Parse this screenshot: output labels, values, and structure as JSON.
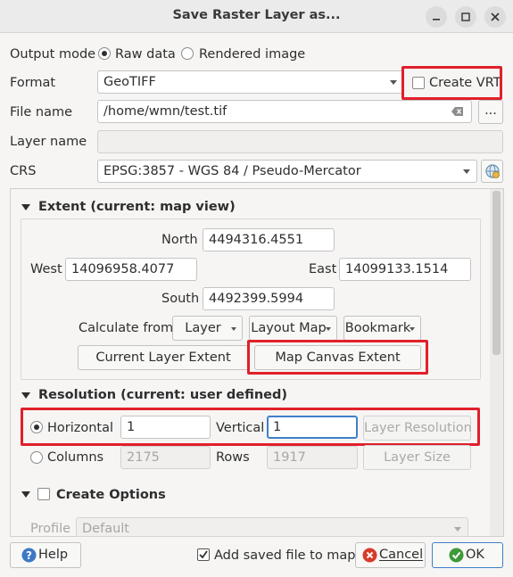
{
  "window": {
    "title": "Save Raster Layer as..."
  },
  "output_mode": {
    "label": "Output mode",
    "raw": "Raw data",
    "rendered": "Rendered image"
  },
  "format": {
    "label": "Format",
    "value": "GeoTIFF",
    "create_vrt": "Create VRT"
  },
  "file_name": {
    "label": "File name",
    "value": "/home/wmn/test.tif",
    "browse": "..."
  },
  "layer_name": {
    "label": "Layer name",
    "value": ""
  },
  "crs": {
    "label": "CRS",
    "value": "EPSG:3857 - WGS 84 / Pseudo-Mercator"
  },
  "extent": {
    "title": "Extent (current: map view)",
    "north_label": "North",
    "north": "4494316.4551",
    "west_label": "West",
    "west": "14096958.4077",
    "east_label": "East",
    "east": "14099133.1514",
    "south_label": "South",
    "south": "4492399.5994",
    "calc_from": "Calculate from",
    "layer_btn": "Layer",
    "layout_btn": "Layout Map",
    "bookmark_btn": "Bookmark",
    "current_layer_extent": "Current Layer Extent",
    "map_canvas_extent": "Map Canvas Extent"
  },
  "resolution": {
    "title": "Resolution (current: user defined)",
    "horizontal_label": "Horizontal",
    "horizontal": "1",
    "vertical_label": "Vertical",
    "vertical": "1",
    "layer_resolution": "Layer Resolution",
    "columns_label": "Columns",
    "columns": "2175",
    "rows_label": "Rows",
    "rows": "1917",
    "layer_size": "Layer Size"
  },
  "create_options": {
    "title": "Create Options",
    "profile_label": "Profile",
    "profile": "Default"
  },
  "footer": {
    "help": "Help",
    "add_to_map": "Add saved file to map",
    "cancel": "Cancel",
    "ok": "OK"
  },
  "colors": {
    "highlight": "#e0202a",
    "focus": "#3f7fc8"
  }
}
